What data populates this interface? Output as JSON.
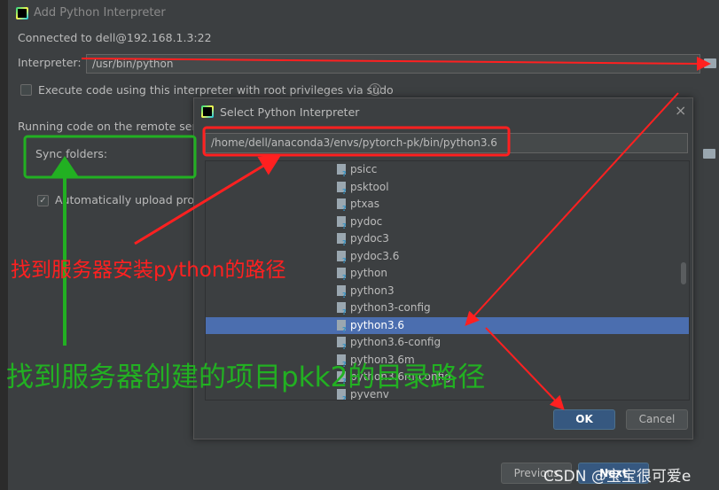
{
  "outer": {
    "title": "Add Python Interpreter",
    "connected": "Connected to dell@192.168.1.3:22",
    "interpreter_label": "Interpreter:",
    "interpreter_value": "/usr/bin/python",
    "sudo_label": "Execute code using this interpreter with root privileges via sudo",
    "sudo_checked": false,
    "running_label": "Running code on the remote serve",
    "sync_label": "Sync folders:",
    "auto_upload_label": "Automatically upload proje",
    "auto_upload_checked": true,
    "previous_button": "Previous",
    "next_button": "Next"
  },
  "dialog": {
    "title": "Select Python Interpreter",
    "path": "/home/dell/anaconda3/envs/pytorch-pk/bin/python3.6",
    "files": [
      "psicc",
      "psktool",
      "ptxas",
      "pydoc",
      "pydoc3",
      "pydoc3.6",
      "python",
      "python3",
      "python3-config",
      "python3.6",
      "python3.6-config",
      "python3.6m",
      "python3.6m-config",
      "pyvenv"
    ],
    "selected": "python3.6",
    "ok": "OK",
    "cancel": "Cancel"
  },
  "annotations": {
    "red_text": "找到服务器安装python的路径",
    "green_text": "找到服务器创建的项目pkk2的目录路径",
    "red_color": "#ff2020",
    "green_color": "#22b022"
  },
  "watermark": "CSDN @宝宝很可爱e"
}
